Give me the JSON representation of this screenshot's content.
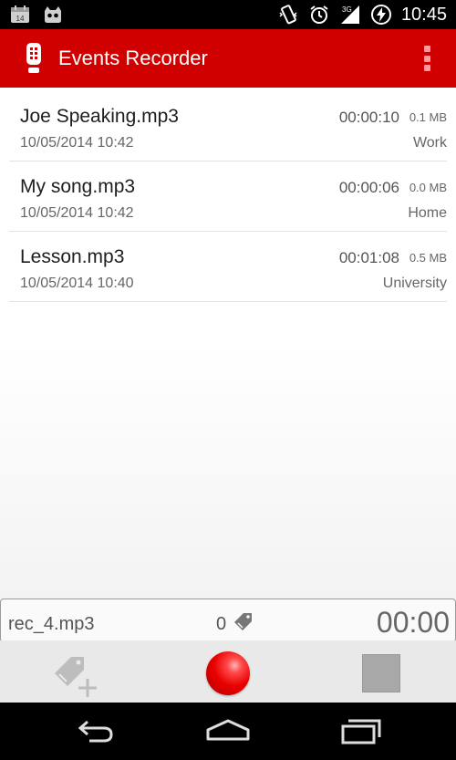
{
  "status_bar": {
    "time": "10:45",
    "notification_icons": [
      "calendar-icon",
      "cyanogen-icon"
    ],
    "system_icons": [
      "vibrate-icon",
      "alarm-icon",
      "signal-3g-icon",
      "charging-icon"
    ]
  },
  "action_bar": {
    "title": "Events Recorder",
    "app_icon": "microphone-icon",
    "overflow_icon": "overflow-menu-icon",
    "color": "#d10000"
  },
  "recordings": [
    {
      "name": "Joe Speaking.mp3",
      "date": "10/05/2014 10:42",
      "duration": "00:00:10",
      "size": "0.1 MB",
      "category": "Work"
    },
    {
      "name": "My song.mp3",
      "date": "10/05/2014 10:42",
      "duration": "00:00:06",
      "size": "0.0 MB",
      "category": "Home"
    },
    {
      "name": "Lesson.mp3",
      "date": "10/05/2014 10:40",
      "duration": "00:01:08",
      "size": "0.5 MB",
      "category": "University"
    }
  ],
  "recorder": {
    "filename": "rec_4.mp3",
    "tag_count": "0",
    "timer": "00:00"
  },
  "controls": {
    "add_tag_icon": "add-tag-icon",
    "record_icon": "record-icon",
    "stop_icon": "stop-icon",
    "record_color": "#e90000"
  },
  "nav_bar": {
    "icons": [
      "back-icon",
      "home-icon",
      "recent-apps-icon"
    ]
  }
}
